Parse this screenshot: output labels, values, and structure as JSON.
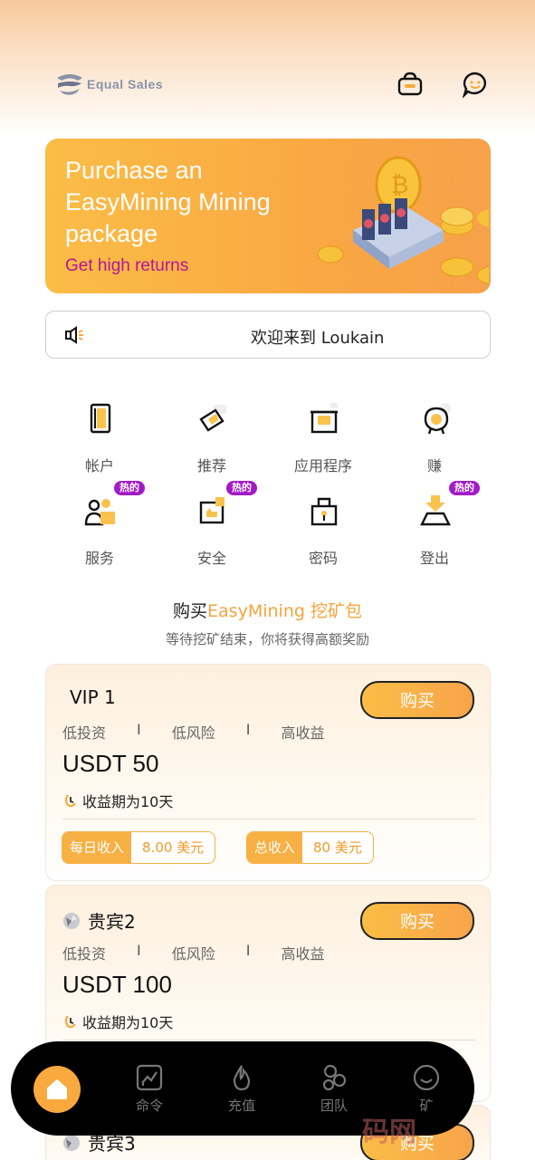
{
  "header": {
    "logo_text": "Equal Sales",
    "icons": [
      "bag-icon",
      "chat-icon"
    ]
  },
  "banner": {
    "title": "Purchase an EasyMining Mining package",
    "subtitle": "Get high returns"
  },
  "notice": {
    "text": "欢迎来到 Loukain"
  },
  "menu": [
    {
      "label": "帐户",
      "icon": "account-icon",
      "hot": false
    },
    {
      "label": "推荐",
      "icon": "referral-icon",
      "hot": false
    },
    {
      "label": "应用程序",
      "icon": "app-icon",
      "hot": false
    },
    {
      "label": "赚",
      "icon": "earn-icon",
      "hot": false
    },
    {
      "label": "服务",
      "icon": "service-icon",
      "hot": true
    },
    {
      "label": "安全",
      "icon": "security-icon",
      "hot": true
    },
    {
      "label": "密码",
      "icon": "password-icon",
      "hot": false
    },
    {
      "label": "登出",
      "icon": "logout-icon",
      "hot": true
    }
  ],
  "hot_label": "热的",
  "section": {
    "title_prefix": "购买",
    "title_accent": "EasyMining 挖矿包",
    "subtitle": "等待挖矿结束，你将获得高额奖励"
  },
  "packages": [
    {
      "name": "VIP 1",
      "buy_label": "购买",
      "features": [
        "低投资",
        "低风险",
        "高收益"
      ],
      "price": "USDT 50",
      "period": "收益期为10天",
      "daily_label": "每日收入",
      "daily_value": "8.00 美元",
      "total_label": "总收入",
      "total_value": "80 美元"
    },
    {
      "name": "贵宾2",
      "buy_label": "购买",
      "features": [
        "低投资",
        "低风险",
        "高收益"
      ],
      "price": "USDT 100",
      "period": "收益期为10天"
    },
    {
      "name": "贵宾3",
      "buy_label": "购买"
    }
  ],
  "separator": "I",
  "nav": {
    "items": [
      {
        "label": "命令",
        "icon": "orders-icon"
      },
      {
        "label": "充值",
        "icon": "recharge-icon"
      },
      {
        "label": "团队",
        "icon": "team-icon"
      },
      {
        "label": "矿",
        "icon": "mine-icon"
      }
    ]
  },
  "watermark": "码网",
  "colors": {
    "accent": "#f9a93d",
    "hot_badge": "#a31ac7",
    "banner_subtitle": "#b4159a"
  }
}
